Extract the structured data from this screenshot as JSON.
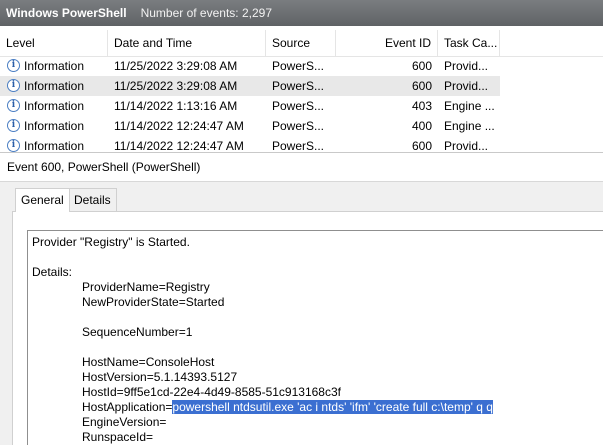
{
  "window": {
    "title": "Windows PowerShell",
    "event_count_text": "Number of events: 2,297"
  },
  "columns": {
    "level": "Level",
    "date_time": "Date and Time",
    "source": "Source",
    "event_id": "Event ID",
    "task_category": "Task Ca..."
  },
  "events": [
    {
      "level": "Information",
      "date_time": "11/25/2022 3:29:08 AM",
      "source": "PowerS...",
      "event_id": "600",
      "task_category": "Provid...",
      "selected": false
    },
    {
      "level": "Information",
      "date_time": "11/25/2022 3:29:08 AM",
      "source": "PowerS...",
      "event_id": "600",
      "task_category": "Provid...",
      "selected": true
    },
    {
      "level": "Information",
      "date_time": "11/14/2022 1:13:16 AM",
      "source": "PowerS...",
      "event_id": "403",
      "task_category": "Engine ...",
      "selected": false
    },
    {
      "level": "Information",
      "date_time": "11/14/2022 12:24:47 AM",
      "source": "PowerS...",
      "event_id": "400",
      "task_category": "Engine ...",
      "selected": false
    },
    {
      "level": "Information",
      "date_time": "11/14/2022 12:24:47 AM",
      "source": "PowerS...",
      "event_id": "600",
      "task_category": "Provid...",
      "selected": false
    }
  ],
  "details": {
    "header": "Event 600, PowerShell (PowerShell)",
    "tabs": {
      "general": "General",
      "details": "Details"
    },
    "message": {
      "line1": "Provider \"Registry\" is Started.",
      "details_label": "Details:",
      "provider_name": "ProviderName=Registry",
      "new_provider_state": "NewProviderState=Started",
      "sequence_number": "SequenceNumber=1",
      "host_name": "HostName=ConsoleHost",
      "host_version": "HostVersion=5.1.14393.5127",
      "host_id": "HostId=9ff5e1cd-22e4-4d49-8585-51c913168c3f",
      "host_application_key": "HostApplication=",
      "host_application_value": "powershell ntdsutil.exe 'ac i ntds' 'ifm' 'create full c:\\temp' q q",
      "engine_version": "EngineVersion=",
      "runspace_id": "RunspaceId="
    }
  },
  "colors": {
    "selection": "#3b6fd1",
    "row_selected": "#e8e8e8",
    "info_icon": "#4a7ec3"
  },
  "icons": {
    "level_icon": "information-icon"
  }
}
